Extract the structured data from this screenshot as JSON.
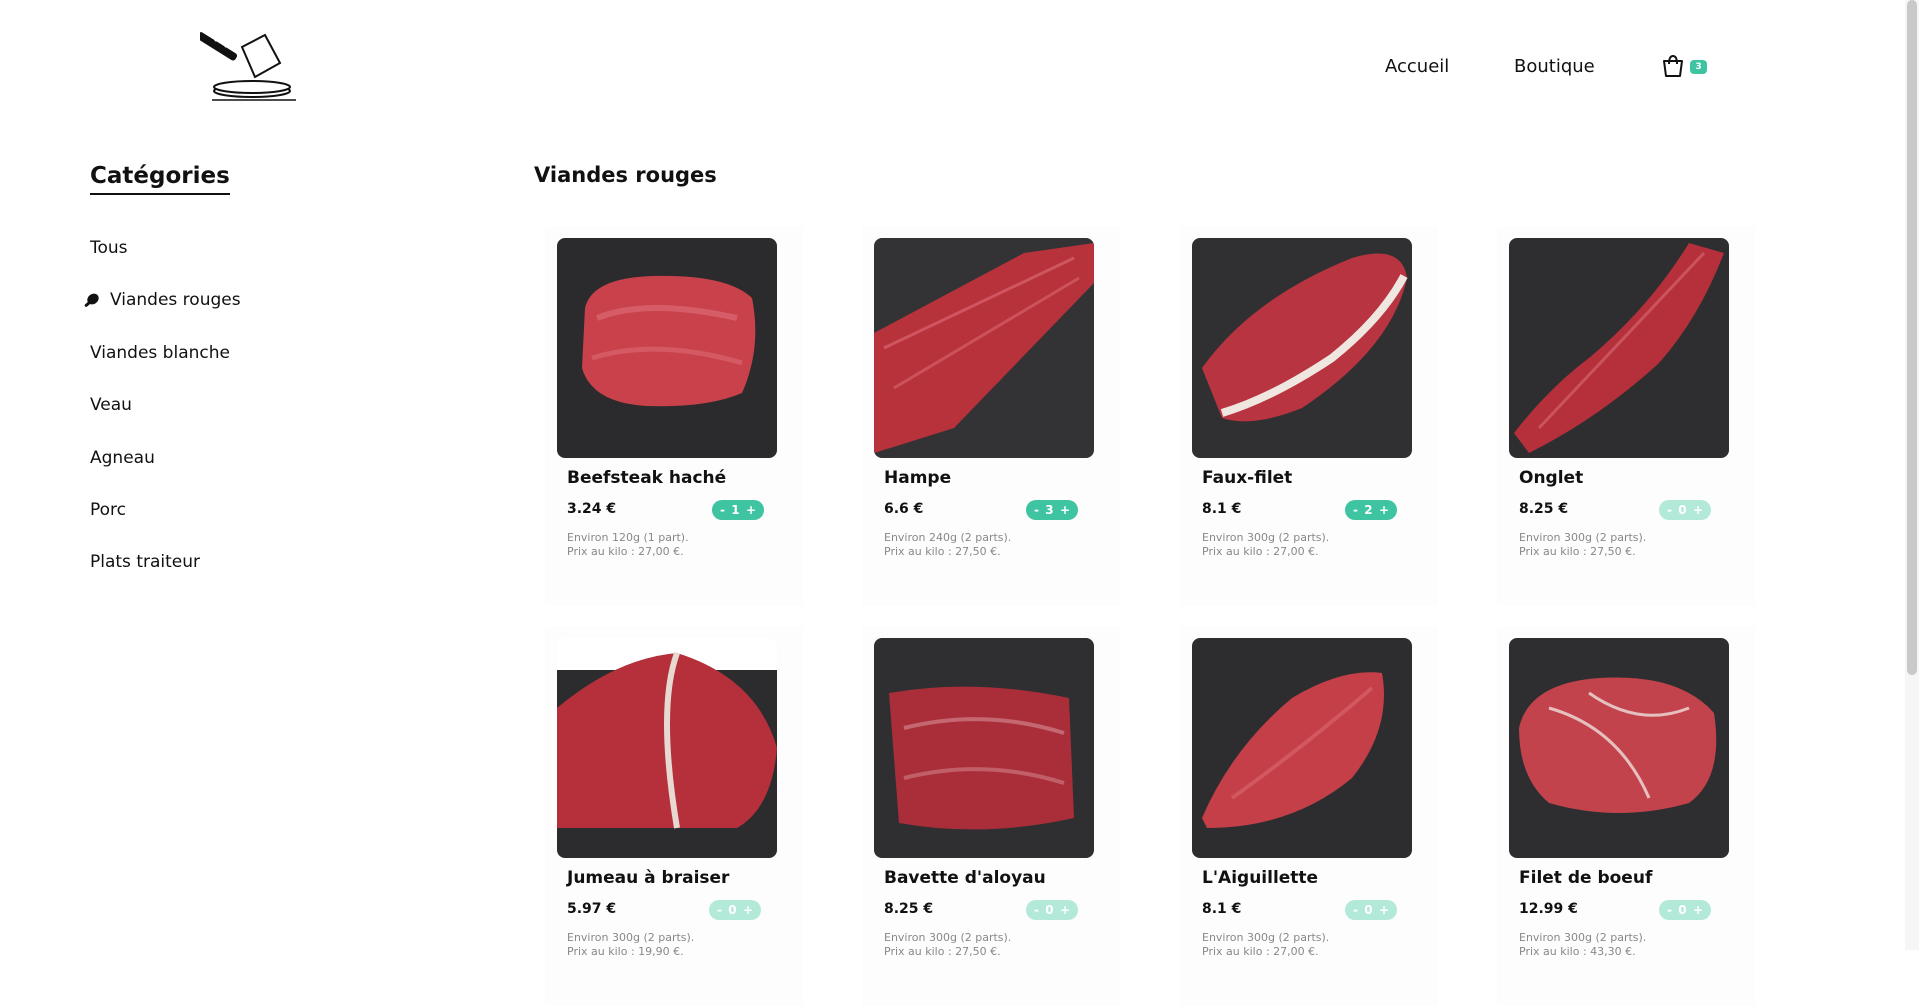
{
  "nav": {
    "home": "Accueil",
    "shop": "Boutique",
    "cart_count": "3",
    "cart_icon": "cart-icon"
  },
  "sidebar": {
    "title": "Catégories",
    "items": [
      {
        "label": "Tous"
      },
      {
        "label": "Viandes rouges",
        "active": true
      },
      {
        "label": "Viandes blanche"
      },
      {
        "label": "Veau"
      },
      {
        "label": "Agneau"
      },
      {
        "label": "Porc"
      },
      {
        "label": "Plats traiteur"
      }
    ]
  },
  "main": {
    "title": "Viandes rouges",
    "products": [
      {
        "name": "Beefsteak haché",
        "price": "3.24 €",
        "qty": "1",
        "minus": "-",
        "plus": "+",
        "desc1": "Environ 120g (1 part).",
        "desc2": "Prix au kilo : 27,00 €."
      },
      {
        "name": "Hampe",
        "price": "6.6 €",
        "qty": "3",
        "minus": "-",
        "plus": "+",
        "desc1": "Environ 240g (2 parts).",
        "desc2": "Prix au kilo : 27,50 €."
      },
      {
        "name": "Faux-filet",
        "price": "8.1 €",
        "qty": "2",
        "minus": "-",
        "plus": "+",
        "desc1": "Environ 300g (2 parts).",
        "desc2": "Prix au kilo : 27,00 €."
      },
      {
        "name": "Onglet",
        "price": "8.25 €",
        "qty": "0",
        "minus": "-",
        "plus": "+",
        "desc1": "Environ 300g (2 parts).",
        "desc2": "Prix au kilo : 27,50 €."
      },
      {
        "name": "Jumeau à braiser",
        "price": "5.97 €",
        "qty": "0",
        "minus": "-",
        "plus": "+",
        "desc1": "Environ 300g (2 parts).",
        "desc2": "Prix au kilo : 19,90 €."
      },
      {
        "name": "Bavette d'aloyau",
        "price": "8.25 €",
        "qty": "0",
        "minus": "-",
        "plus": "+",
        "desc1": "Environ 300g (2 parts).",
        "desc2": "Prix au kilo : 27,50 €."
      },
      {
        "name": "L'Aiguillette",
        "price": "8.1 €",
        "qty": "0",
        "minus": "-",
        "plus": "+",
        "desc1": "Environ 300g (2 parts).",
        "desc2": "Prix au kilo : 27,00 €."
      },
      {
        "name": "Filet de boeuf",
        "price": "12.99 €",
        "qty": "0",
        "minus": "-",
        "plus": "+",
        "desc1": "Environ 300g (2 parts).",
        "desc2": "Prix au kilo : 43,30 €."
      }
    ]
  },
  "colors": {
    "accent": "#3ec4a0",
    "accent_light": "#b3e9d8",
    "meat": "#b8323c",
    "slate": "#2b2b2d"
  }
}
